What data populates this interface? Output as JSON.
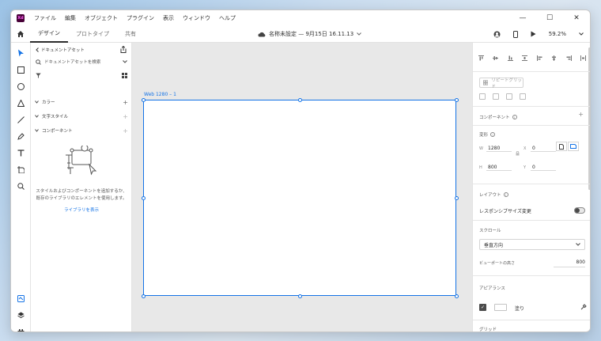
{
  "app": {
    "icon_text": "Xd",
    "menu": [
      "ファイル",
      "編集",
      "オブジェクト",
      "プラグイン",
      "表示",
      "ウィンドウ",
      "ヘルプ"
    ],
    "window_controls": [
      "—",
      "☐",
      "✕"
    ]
  },
  "tabs": {
    "modes": [
      "デザイン",
      "プロトタイプ",
      "共有"
    ],
    "active_mode": "デザイン",
    "doc_title": "名称未設定 — 9月15日 16.11.13",
    "zoom": "59.2%"
  },
  "assets": {
    "header": "ドキュメントアセット",
    "search_placeholder": "ドキュメントアセットを検索",
    "sections": [
      "カラー",
      "文字スタイル",
      "コンポーネント"
    ],
    "empty_message": "スタイルおよびコンポーネントを追加するか、既存のライブラリのエレメントを使用します。",
    "library_link": "ライブラリを表示"
  },
  "canvas": {
    "artboard_label": "Web 1280 – 1",
    "background": "#e8e8e8"
  },
  "properties": {
    "repeat_grid": "リピートグリッド",
    "component_label": "コンポーネント",
    "transform_label": "変形",
    "width_label": "W",
    "width": "1280",
    "height_label": "H",
    "height": "800",
    "x_label": "X",
    "x": "0",
    "y_label": "Y",
    "y": "0",
    "layout_label": "レイアウト",
    "responsive_resize": "レスポンシブサイズ変更",
    "scroll_label": "スクロール",
    "scroll_direction": "垂直方向",
    "viewport_height_label": "ビューポートの高さ",
    "viewport_height": "800",
    "appearance_label": "アピアランス",
    "fill_label": "塗り",
    "grid_label": "グリッド"
  },
  "colors": {
    "accent": "#1473e6",
    "app_icon_bg": "#470137",
    "app_icon_fg": "#ff61f6"
  }
}
